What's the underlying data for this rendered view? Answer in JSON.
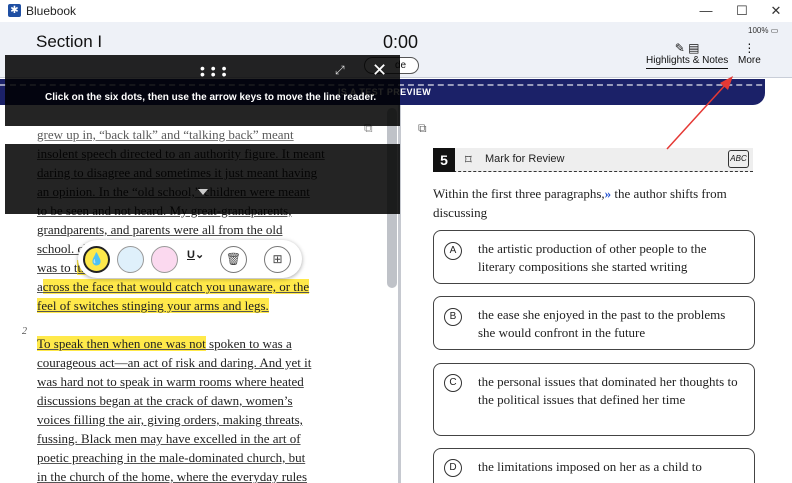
{
  "window": {
    "title": "Bluebook",
    "minimize": "—",
    "maximize": "☐",
    "close": "✕"
  },
  "header": {
    "section": "Section I",
    "timer": "0:00",
    "hide_label": "de",
    "battery": "100%",
    "highlights_notes": "Highlights & Notes",
    "more": "More"
  },
  "banner": {
    "text": "IS A TEST PREVIEW"
  },
  "line_reader": {
    "instruction": "Click on the six dots, then use the arrow keys to move the line reader."
  },
  "passage": {
    "para2_number": "2",
    "lines": [
      {
        "segments": [
          {
            "t": "grew up in, “back talk” and “talking back” meant",
            "u": true,
            "h": false
          }
        ]
      },
      {
        "segments": [
          {
            "t": "insolent speech directed to an authority figure. It meant",
            "u": true,
            "h": false
          }
        ]
      },
      {
        "segments": [
          {
            "t": "daring to disagree and sometimes it just meant having",
            "u": true,
            "h": false
          }
        ]
      },
      {
        "segments": [
          {
            "t": "an opinion. In the “old school,” children were meant",
            "u": true,
            "h": false
          }
        ]
      },
      {
        "segments": [
          {
            "t": "to be seen and not heard. My great-grandparents,",
            "u": true,
            "h": false
          }
        ]
      },
      {
        "segments": [
          {
            "t": "grandparents, and parents were all from the old",
            "u": true,
            "h": false
          }
        ]
      },
      {
        "segments": [
          {
            "t": "school. ",
            "u": true,
            "h": false
          },
          {
            "t": "child",
            "u": true,
            "h": false
          }
        ]
      },
      {
        "segments": [
          {
            "t": "was to t",
            "u": true,
            "h": false
          },
          {
            "t": "the slap",
            "u": true,
            "h": true
          }
        ]
      },
      {
        "segments": [
          {
            "t": "a",
            "u": true,
            "h": false
          },
          {
            "t": "cross the face that would catch you unaware, or the",
            "u": true,
            "h": true
          }
        ]
      },
      {
        "segments": [
          {
            "t": "feel of switches stinging your arms and legs.",
            "u": true,
            "h": true
          }
        ]
      },
      {
        "segments": [
          {
            "t": "",
            "u": false,
            "h": false
          }
        ]
      },
      {
        "segments": [
          {
            "t": "  To speak then when one was not",
            "u": true,
            "h": true
          },
          {
            "t": " spoken to was a",
            "u": true,
            "h": false
          }
        ]
      },
      {
        "segments": [
          {
            "t": "courageous act—an act of risk and daring. And yet it",
            "u": true,
            "h": false
          }
        ]
      },
      {
        "segments": [
          {
            "t": "was hard not to speak in warm rooms where heated",
            "u": true,
            "h": false
          }
        ]
      },
      {
        "segments": [
          {
            "t": "discussions began at the crack of dawn, women’s",
            "u": true,
            "h": false
          }
        ]
      },
      {
        "segments": [
          {
            "t": "voices filling the air, giving orders, making threats,",
            "u": true,
            "h": false
          }
        ]
      },
      {
        "segments": [
          {
            "t": "fussing. Black men may have excelled in the art of",
            "u": true,
            "h": false
          }
        ]
      },
      {
        "segments": [
          {
            "t": "poetic preaching in the male-dominated church, but",
            "u": true,
            "h": false
          }
        ]
      },
      {
        "segments": [
          {
            "t": "in the church of the home, where the everyday rules",
            "u": true,
            "h": false
          }
        ]
      }
    ]
  },
  "question": {
    "number": "5",
    "mark_label": "Mark for Review",
    "abc_label": "ABC",
    "stem_before": "Within the first three paragraphs,",
    "stem_arrows": "»",
    "stem_after": " the author shifts from discussing",
    "choices": [
      {
        "letter": "A",
        "text": "the artistic production of other people to the literary compositions she started writing"
      },
      {
        "letter": "B",
        "text": "the ease she enjoyed in the past to the problems she would confront in the future"
      },
      {
        "letter": "C",
        "text": "the personal issues that dominated her thoughts to the political issues that defined her time"
      },
      {
        "letter": "D",
        "text": "the limitations imposed on her as a child to"
      }
    ]
  },
  "colors": {
    "banner": "#1b2168",
    "highlight": "#ffe94a",
    "arrow": "#e53935"
  }
}
